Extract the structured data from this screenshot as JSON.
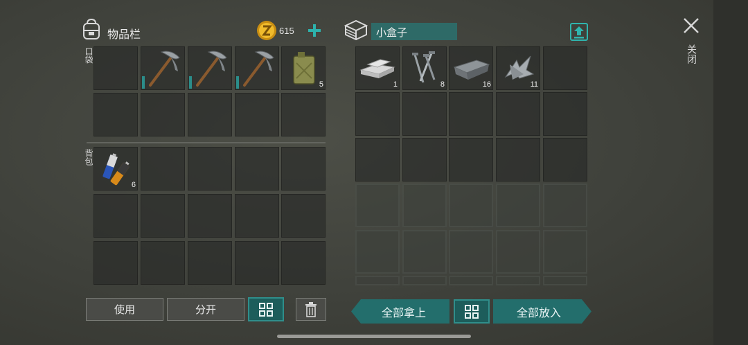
{
  "inventory": {
    "title": "物品栏",
    "currency": "615",
    "pocket_label": "口袋",
    "backpack_label": "背包",
    "pocket_slots": [
      {
        "item": "",
        "count": ""
      },
      {
        "item": "pickaxe-icon",
        "count": ""
      },
      {
        "item": "pickaxe-icon",
        "count": ""
      },
      {
        "item": "pickaxe-icon",
        "count": ""
      },
      {
        "item": "jerrycan-icon",
        "count": "5"
      },
      {
        "item": "",
        "count": ""
      },
      {
        "item": "",
        "count": ""
      },
      {
        "item": "",
        "count": ""
      },
      {
        "item": "",
        "count": ""
      },
      {
        "item": "",
        "count": ""
      }
    ],
    "backpack_slots": [
      {
        "item": "batteries-icon",
        "count": "6"
      }
    ]
  },
  "container": {
    "name": "小盒子",
    "slots": [
      {
        "item": "metal-bars-icon",
        "count": "1"
      },
      {
        "item": "nails-icon",
        "count": "8"
      },
      {
        "item": "iron-ingot-icon",
        "count": "16"
      },
      {
        "item": "metal-scrap-icon",
        "count": "11"
      }
    ]
  },
  "buttons": {
    "use": "使用",
    "split": "分开",
    "take_all": "全部拿上",
    "put_all": "全部放入",
    "close": "关闭"
  },
  "colors": {
    "accent": "#236e6c",
    "accent_border": "#2f8e8b",
    "coin": "#e0a81a"
  }
}
